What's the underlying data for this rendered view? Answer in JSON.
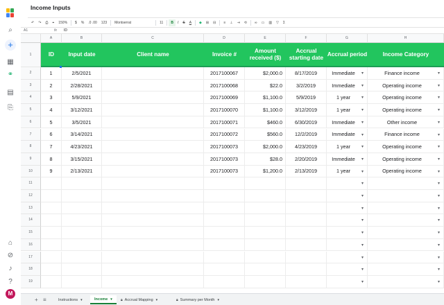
{
  "app": {
    "title": "Income Inputs"
  },
  "toolbar": {
    "zoom": "150%",
    "currency": "$",
    "percent": "%",
    "decimals": ".0 .00",
    "format": "123",
    "font": "Montserrat",
    "font_size": "11",
    "bold": "B",
    "italic": "I",
    "strike": "S",
    "text_color": "A"
  },
  "formula_bar": {
    "cell_ref": "A1",
    "fx": "fx",
    "value": "ID"
  },
  "columns": [
    "A",
    "B",
    "C",
    "D",
    "E",
    "F",
    "G",
    "H"
  ],
  "headers": {
    "id": "ID",
    "input_date": "Input date",
    "client": "Client name",
    "invoice": "Invoice #",
    "amount": "Amount received ($)",
    "accrual_start": "Accrual starting date",
    "accrual_period": "Accrual period",
    "category": "Income Category"
  },
  "rows": [
    {
      "num": "2",
      "id": "1",
      "date": "2/5/2021",
      "client": "",
      "invoice": "2017100067",
      "amount": "$2,000.0",
      "start": "8/17/2019",
      "period": "Immediate",
      "category": "Finance income"
    },
    {
      "num": "3",
      "id": "2",
      "date": "2/28/2021",
      "client": "",
      "invoice": "2017100068",
      "amount": "$22.0",
      "start": "3/2/2019",
      "period": "Immediate",
      "category": "Operating income"
    },
    {
      "num": "4",
      "id": "3",
      "date": "5/9/2021",
      "client": "",
      "invoice": "2017100069",
      "amount": "$1,100.0",
      "start": "5/9/2019",
      "period": "1 year",
      "category": "Operating income"
    },
    {
      "num": "5",
      "id": "4",
      "date": "3/12/2021",
      "client": "",
      "invoice": "2017100070",
      "amount": "$1,100.0",
      "start": "3/12/2019",
      "period": "1 year",
      "category": "Operating income"
    },
    {
      "num": "6",
      "id": "5",
      "date": "3/5/2021",
      "client": "",
      "invoice": "2017100071",
      "amount": "$460.0",
      "start": "6/30/2019",
      "period": "Immediate",
      "category": "Other income"
    },
    {
      "num": "7",
      "id": "6",
      "date": "3/14/2021",
      "client": "",
      "invoice": "2017100072",
      "amount": "$560.0",
      "start": "12/2/2019",
      "period": "Immediate",
      "category": "Finance income"
    },
    {
      "num": "8",
      "id": "7",
      "date": "4/23/2021",
      "client": "",
      "invoice": "2017100073",
      "amount": "$2,000.0",
      "start": "4/23/2019",
      "period": "1 year",
      "category": "Operating income"
    },
    {
      "num": "9",
      "id": "8",
      "date": "3/15/2021",
      "client": "",
      "invoice": "2017100073",
      "amount": "$28.0",
      "start": "2/20/2019",
      "period": "Immediate",
      "category": "Operating income"
    },
    {
      "num": "10",
      "id": "9",
      "date": "2/13/2021",
      "client": "",
      "invoice": "2017100073",
      "amount": "$1,200.0",
      "start": "2/13/2019",
      "period": "1 year",
      "category": "Operating income"
    }
  ],
  "empty_rows": [
    "11",
    "12",
    "13",
    "14",
    "15",
    "16",
    "17",
    "18",
    "19"
  ],
  "header_row_num": "1",
  "sheets": [
    {
      "name": "Instructions",
      "active": false,
      "locked": false
    },
    {
      "name": "Income",
      "active": true,
      "locked": false
    },
    {
      "name": "Accrual Mapping",
      "active": false,
      "locked": true
    },
    {
      "name": "Summary per Month",
      "active": false,
      "locked": true
    }
  ],
  "user": {
    "initial": "M"
  },
  "colors": {
    "header_green": "#22c55e",
    "active_tab": "#188038"
  }
}
